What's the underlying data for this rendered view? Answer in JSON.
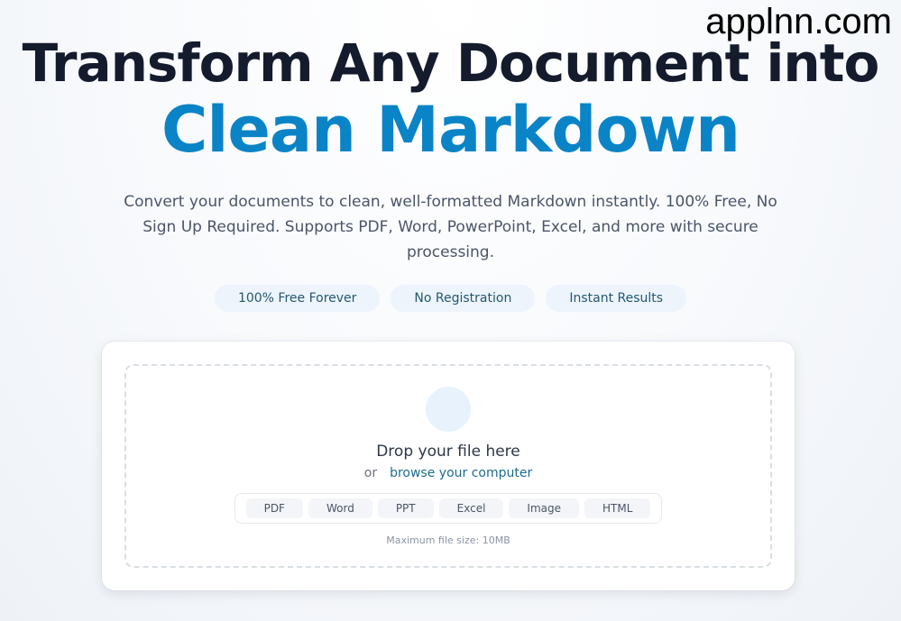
{
  "watermark": "applnn.com",
  "hero": {
    "title_line1": "Transform Any Document into",
    "title_line2": "Clean Markdown",
    "subtitle": "Convert your documents to clean, well-formatted Markdown instantly. 100% Free, No Sign Up Required. Supports PDF, Word, PowerPoint, Excel, and more with secure processing.",
    "badges": [
      "100% Free Forever",
      "No Registration",
      "Instant Results"
    ]
  },
  "upload": {
    "icon": "upload-icon",
    "title": "Drop your file here",
    "or": "or",
    "browse": "browse your computer",
    "formats": [
      "PDF",
      "Word",
      "PPT",
      "Excel",
      "Image",
      "HTML"
    ],
    "max_size": "Maximum file size: 10MB"
  },
  "colors": {
    "accent": "#0a84c6",
    "title": "#141b2d",
    "link": "#1c6c8e"
  }
}
